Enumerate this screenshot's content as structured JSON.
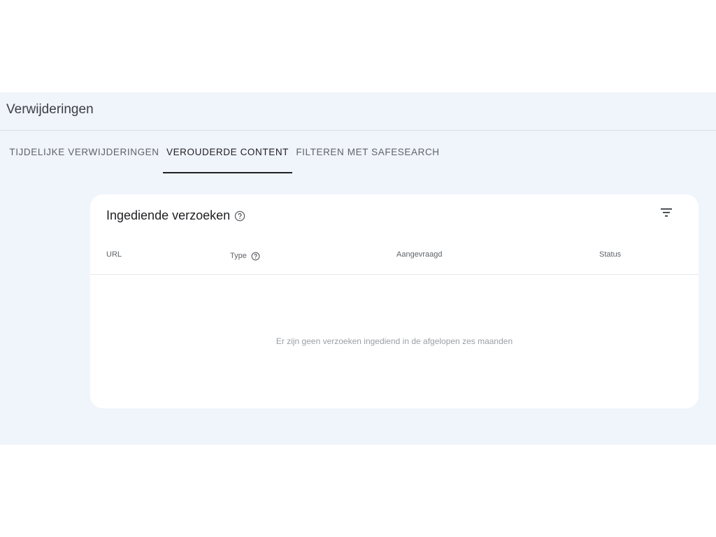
{
  "page": {
    "title": "Verwijderingen"
  },
  "tabs": [
    {
      "label": "TIJDELIJKE VERWIJDERINGEN",
      "active": false
    },
    {
      "label": "VEROUDERDE CONTENT",
      "active": true
    },
    {
      "label": "FILTEREN MET SAFESEARCH",
      "active": false
    }
  ],
  "card": {
    "title": "Ingediende verzoeken",
    "help_icon": "help-circle-icon",
    "filter_icon": "filter-list-icon",
    "columns": [
      "URL",
      "Type",
      "Aangevraagd",
      "Status"
    ],
    "empty_message": "Er zijn geen verzoeken ingediend in de afgelopen zes maanden"
  },
  "colors": {
    "panel_bg": "#f0f4fb",
    "card_bg": "#ffffff",
    "active_tab": "#202124",
    "inactive_tab": "#5f6368"
  }
}
